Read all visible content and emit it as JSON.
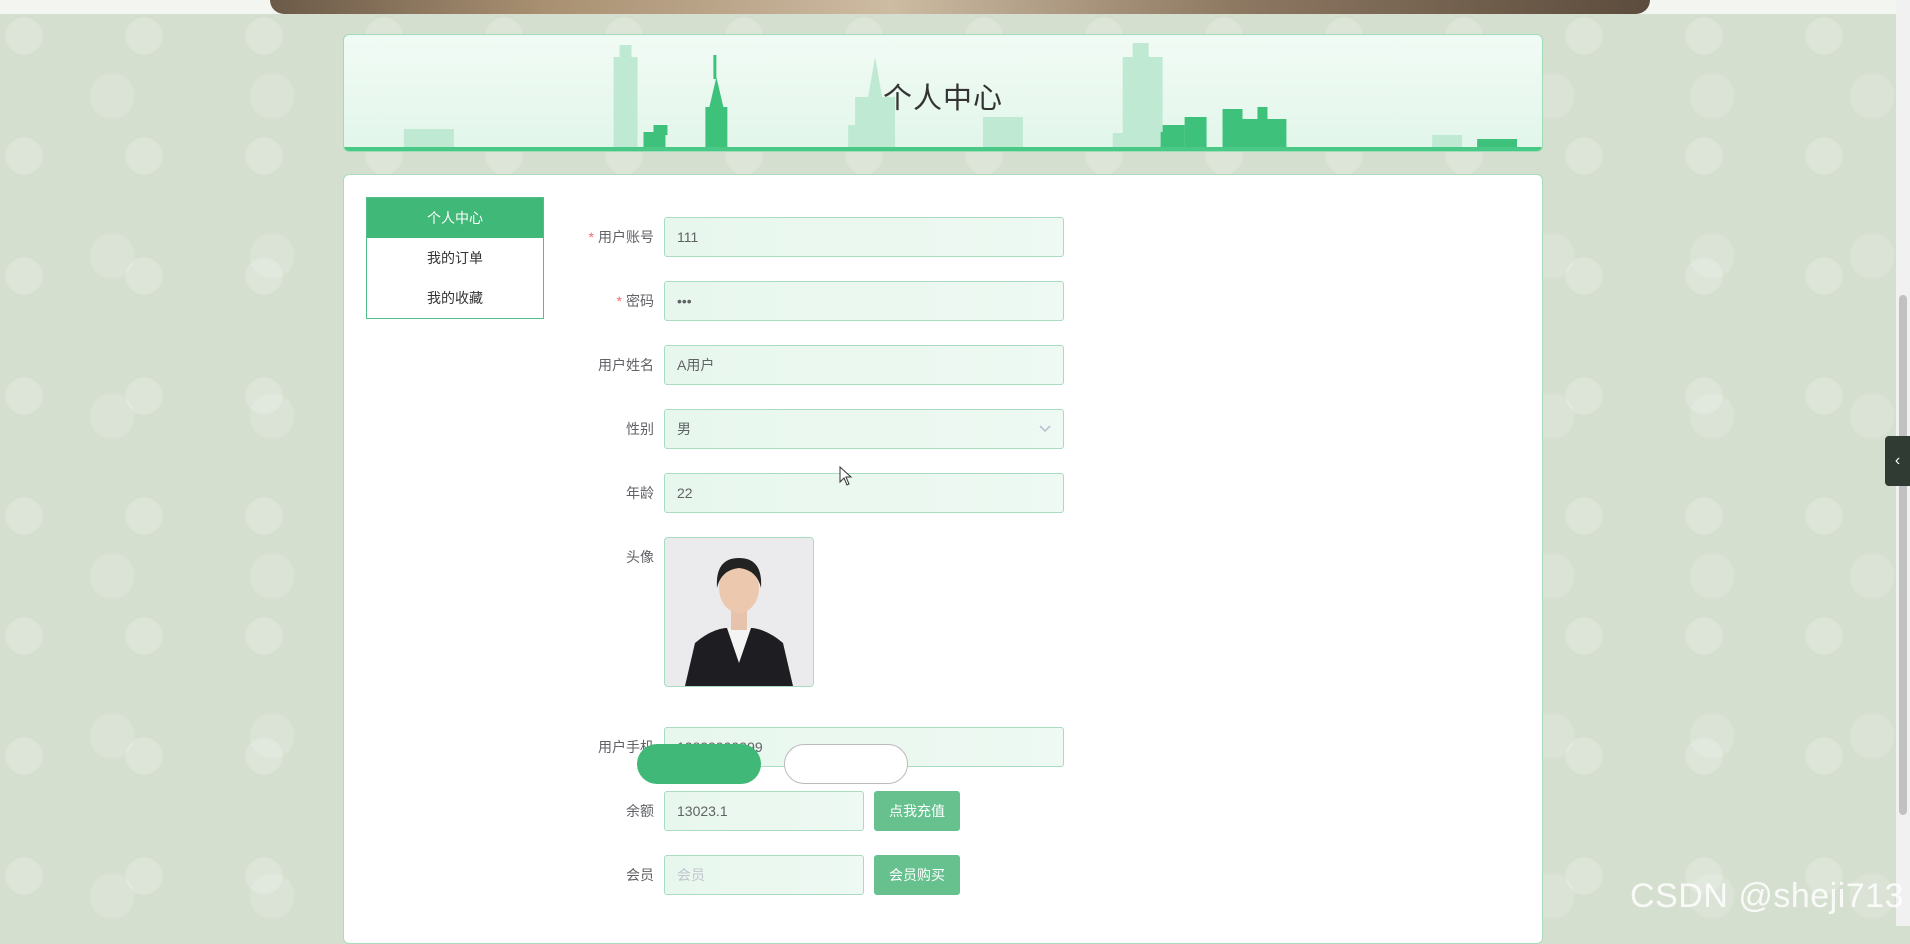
{
  "page": {
    "title": "个人中心"
  },
  "side_menu": {
    "items": [
      {
        "label": "个人中心",
        "active": true
      },
      {
        "label": "我的订单",
        "active": false
      },
      {
        "label": "我的收藏",
        "active": false
      }
    ]
  },
  "form": {
    "account": {
      "label": "用户账号",
      "value": "111",
      "required": true
    },
    "password": {
      "label": "密码",
      "value": "•••",
      "required": true
    },
    "name": {
      "label": "用户姓名",
      "value": "A用户"
    },
    "gender": {
      "label": "性别",
      "value": "男"
    },
    "age": {
      "label": "年龄",
      "value": "22"
    },
    "avatar": {
      "label": "头像"
    },
    "phone": {
      "label": "用户手机",
      "value": "13899999999"
    },
    "balance": {
      "label": "余额",
      "value": "13023.1",
      "button": "点我充值"
    },
    "member": {
      "label": "会员",
      "placeholder": "会员",
      "button": "会员购买"
    }
  },
  "watermark": "CSDN @sheji713",
  "colors": {
    "accent": "#3fb878",
    "button": "#66c18f",
    "input_bg": "#e8f7ee"
  },
  "icons": {
    "select_arrow": "chevron-down-icon",
    "side_toggle": "chevron-left-icon"
  }
}
